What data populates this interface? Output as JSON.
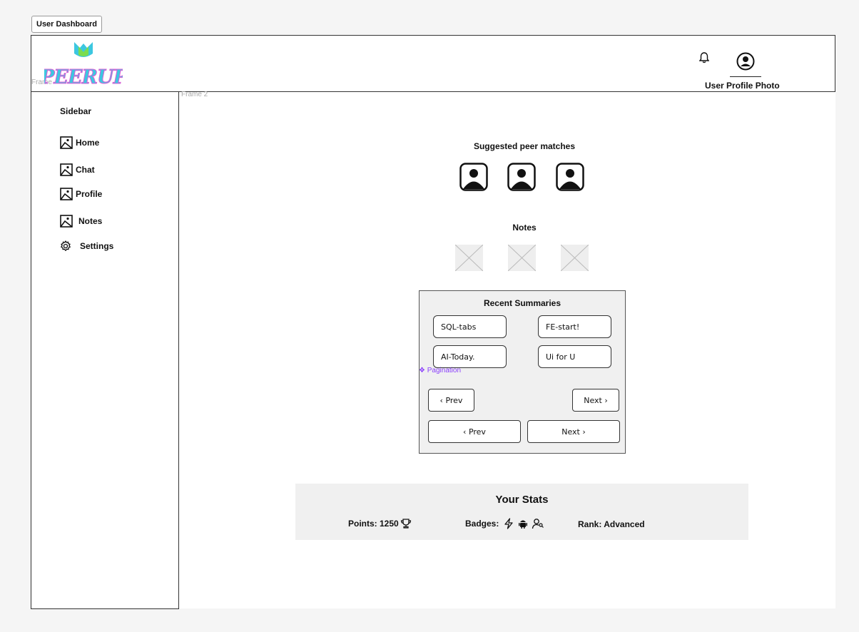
{
  "frame_tag": "User Dashboard",
  "header": {
    "frame_label": "Frame",
    "logo_text": "PEERUP",
    "profile_label": "User Profile Photo"
  },
  "frame2_label": "Frame 2",
  "sidebar": {
    "title": "Sidebar",
    "items": [
      {
        "label": "Home",
        "icon": "image-icon"
      },
      {
        "label": "Chat",
        "icon": "image-icon"
      },
      {
        "label": "Profile",
        "icon": "image-icon"
      },
      {
        "label": "Notes",
        "icon": "image-icon"
      },
      {
        "label": "Settings",
        "icon": "gear-icon"
      }
    ]
  },
  "main": {
    "peers_title": "Suggested peer matches",
    "notes_title": "Notes",
    "summaries": {
      "title": "Recent Summaries",
      "items": [
        "SQL-tabs",
        "FE-start!",
        "AI-Today.",
        "Ui for U"
      ],
      "pagination_label": "❖ Pagination",
      "prev_label": "‹  Prev",
      "next_label": "Next  ›"
    },
    "stats": {
      "title": "Your Stats",
      "points": "Points: 1250",
      "badges": "Badges:",
      "rank": "Rank: Advanced"
    }
  },
  "colors": {
    "logo_primary": "#3cc7e0",
    "logo_accent": "#e05bd6",
    "pagination": "#8a3ffc"
  }
}
